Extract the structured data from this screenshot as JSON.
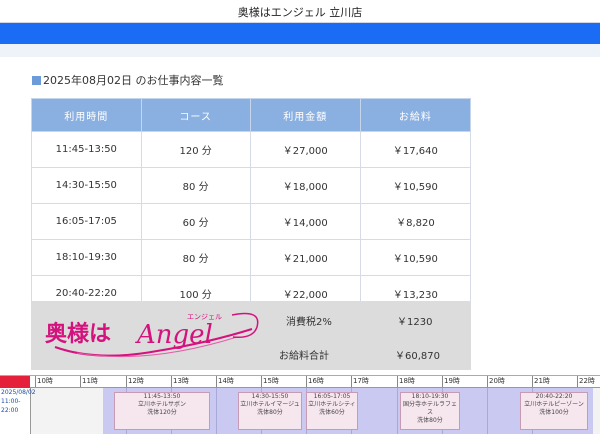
{
  "header": {
    "title": "奥様はエンジェル 立川店"
  },
  "section": {
    "title": "2025年08月02日 のお仕事内容一覧"
  },
  "table": {
    "columns": [
      "利用時間",
      "コース",
      "利用金額",
      "お給料"
    ],
    "rows": [
      [
        "11:45-13:50",
        "120 分",
        "￥27,000",
        "￥17,640"
      ],
      [
        "14:30-15:50",
        "80 分",
        "￥18,000",
        "￥10,590"
      ],
      [
        "16:05-17:05",
        "60 分",
        "￥14,000",
        "￥8,820"
      ],
      [
        "18:10-19:30",
        "80 分",
        "￥21,000",
        "￥10,590"
      ],
      [
        "20:40-22:20",
        "100 分",
        "￥22,000",
        "￥13,230"
      ]
    ]
  },
  "footer": {
    "logo_text_main": "奥様は",
    "logo_text_script": "Angel",
    "logo_text_small": "エンジェル",
    "tax_label": "消費税2%",
    "tax_value": "￥1230",
    "total_label": "お給料合計",
    "total_value": "￥60,870"
  },
  "timeline": {
    "date": "2025/08/02",
    "range": "11:00-22:00",
    "hours": [
      "10時",
      "11時",
      "12時",
      "13時",
      "14時",
      "15時",
      "16時",
      "17時",
      "18時",
      "19時",
      "20時",
      "21時",
      "22時"
    ],
    "blocks": [
      {
        "time": "11:45-13:50",
        "hotel": "立川ホテルサボン",
        "detail": "洗体120分"
      },
      {
        "time": "14:30-15:50",
        "hotel": "立川ホテルイマージュ",
        "detail": "洗体80分"
      },
      {
        "time": "16:05-17:05",
        "hotel": "立川ホテルシティ",
        "detail": "洗体60分"
      },
      {
        "time": "18:10-19:30",
        "hotel": "国分寺ホテルラフェス",
        "detail": "洗体80分"
      },
      {
        "time": "20:40-22:20",
        "hotel": "立川ホテルピーゾーン",
        "detail": "洗体100分"
      }
    ]
  },
  "colors": {
    "accent_blue": "#1a6cf5",
    "table_header": "#8ab0e2",
    "logo_pink": "#d4127d",
    "timeline_red": "#e5203a"
  }
}
